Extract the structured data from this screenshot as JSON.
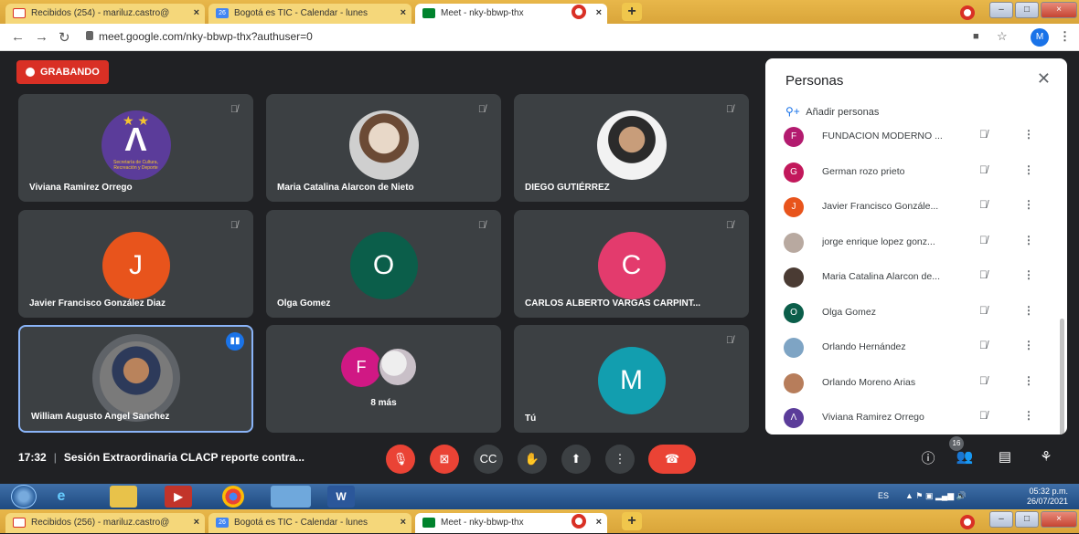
{
  "browser": {
    "tabs": [
      {
        "label": "Recibidos (254) - mariluz.castro@"
      },
      {
        "label": "Bogotá es TIC - Calendar - lunes"
      },
      {
        "label": "Meet - nky-bbwp-thx"
      }
    ],
    "tabs_bottom": [
      {
        "label": "Recibidos (256) - mariluz.castro@"
      },
      {
        "label": "Bogotá es TIC - Calendar - lunes"
      },
      {
        "label": "Meet - nky-bbwp-thx"
      }
    ],
    "url": "meet.google.com/nky-bbwp-thx?authuser=0",
    "profile_initial": "M",
    "calendar_day": "26"
  },
  "meet": {
    "recording_label": "GRABANDO",
    "tiles": [
      {
        "name": "Viviana Ramirez Orrego",
        "logo_letter": "Λ",
        "logo_caption": "Secretaría de Cultura, Recreación y Deporte"
      },
      {
        "name": "Maria Catalina Alarcon de Nieto"
      },
      {
        "name": "DIEGO GUTIÉRREZ"
      },
      {
        "name": "Javier Francisco González Diaz",
        "initial": "J"
      },
      {
        "name": "Olga Gomez",
        "initial": "O"
      },
      {
        "name": "CARLOS ALBERTO VARGAS CARPINT...",
        "initial": "C"
      },
      {
        "name": "William Augusto Angel Sanchez"
      },
      {
        "more_label": "8 más",
        "initial": "F"
      },
      {
        "name": "Tú",
        "initial": "M"
      }
    ],
    "meeting_time": "17:32",
    "meeting_title": "Sesión Extraordinaria CLACP reporte contra...",
    "participants_count": "16"
  },
  "people_panel": {
    "title": "Personas",
    "add_label": "Añadir personas",
    "people": [
      {
        "name": "FUNDACION MODERNO ...",
        "initial": "F",
        "color": "#b31b6f"
      },
      {
        "name": "German rozo prieto",
        "initial": "G",
        "color": "#c2185b"
      },
      {
        "name": "Javier Francisco Gonzále...",
        "initial": "J",
        "color": "#e8541c"
      },
      {
        "name": "jorge enrique lopez gonz...",
        "initial": "",
        "color": "#b8a9a0"
      },
      {
        "name": "Maria Catalina Alarcon de...",
        "initial": "",
        "color": "#4a3b33"
      },
      {
        "name": "Olga Gomez",
        "initial": "O",
        "color": "#0b5e4a"
      },
      {
        "name": "Orlando Hernández",
        "initial": "",
        "color": "#7ea4c4"
      },
      {
        "name": "Orlando Moreno Arias",
        "initial": "",
        "color": "#b77d5b"
      },
      {
        "name": "Viviana Ramirez Orrego",
        "initial": "Λ",
        "color": "#5b3c9a"
      }
    ]
  },
  "taskbar": {
    "lang": "ES",
    "time": "05:32 p.m.",
    "date": "26/07/2021"
  }
}
